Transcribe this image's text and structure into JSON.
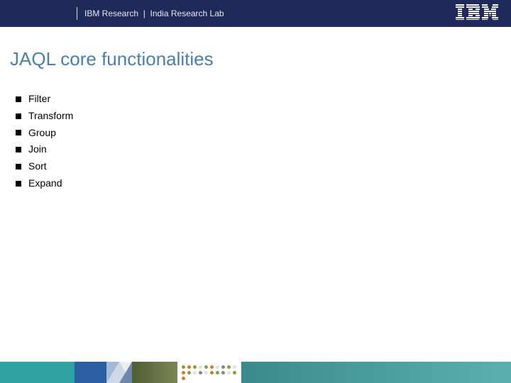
{
  "header": {
    "org": "IBM Research",
    "separator": "|",
    "lab": "India Research Lab",
    "logo_alt": "IBM"
  },
  "title": "JAQL core functionalities",
  "bullets": [
    "Filter",
    "Transform",
    "Group",
    "Join",
    "Sort",
    "Expand"
  ]
}
